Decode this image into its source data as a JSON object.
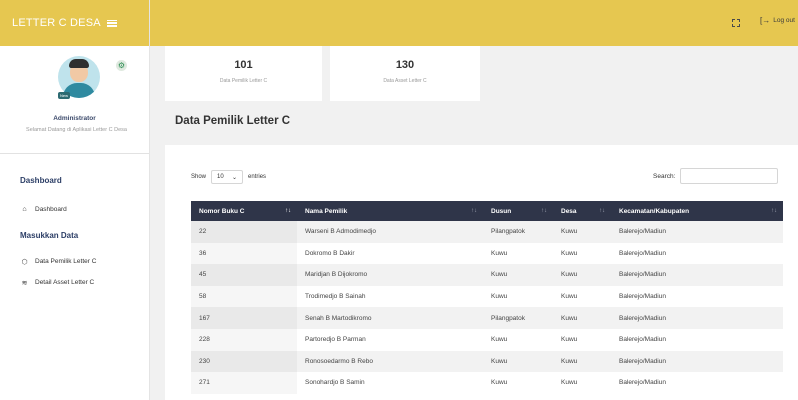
{
  "brand": {
    "title": "LETTER C DESA",
    "menu_icon": "hamburger-icon"
  },
  "profile": {
    "badge": "New",
    "name": "Administrator",
    "welcome": "Selamat Datang di Aplikasi Letter C Desa",
    "settings_icon": "gear-icon"
  },
  "sidebar": {
    "section_dashboard": "Dashboard",
    "item_dashboard": "Dashboard",
    "section_input": "Masukkan Data",
    "item_pemilik": "Data Pemilik Letter C",
    "item_asset": "Detail Asset Letter C"
  },
  "topbar": {
    "logout_label": "Log out",
    "expand_icon": "fullscreen-icon",
    "logout_icon": "logout-icon"
  },
  "stats": [
    {
      "value": "101",
      "label": "Data Pemilik Letter C"
    },
    {
      "value": "130",
      "label": "Data Asset Letter C"
    }
  ],
  "page_title": "Data Pemilik Letter C",
  "table_controls": {
    "show_label": "Show",
    "length_value": "10",
    "entries_label": "entries",
    "search_label": "Search:",
    "search_value": ""
  },
  "table": {
    "headers": [
      "Nomor Buku C",
      "Nama Pemilik",
      "Dusun",
      "Desa",
      "Kecamatan/Kabupaten"
    ],
    "rows": [
      [
        "22",
        "Warseni B Admodimedjo",
        "Pilangpatok",
        "Kuwu",
        "Balerejo/Madiun"
      ],
      [
        "36",
        "Dokromo B Dakir",
        "Kuwu",
        "Kuwu",
        "Balerejo/Madiun"
      ],
      [
        "45",
        "Maridjan B Dijokromo",
        "Kuwu",
        "Kuwu",
        "Balerejo/Madiun"
      ],
      [
        "58",
        "Trodimedjo B Sainah",
        "Kuwu",
        "Kuwu",
        "Balerejo/Madiun"
      ],
      [
        "167",
        "Senah B Martodikromo",
        "Pilangpatok",
        "Kuwu",
        "Balerejo/Madiun"
      ],
      [
        "228",
        "Partoredjo B Parman",
        "Kuwu",
        "Kuwu",
        "Balerejo/Madiun"
      ],
      [
        "230",
        "Ronosoedarmo B Rebo",
        "Kuwu",
        "Kuwu",
        "Balerejo/Madiun"
      ],
      [
        "271",
        "Sonohardjo B Samin",
        "Kuwu",
        "Kuwu",
        "Balerejo/Madiun"
      ]
    ]
  },
  "colors": {
    "accent": "#e6c750",
    "table_header": "#2f3549",
    "sidebar_heading": "#2c3e66"
  }
}
